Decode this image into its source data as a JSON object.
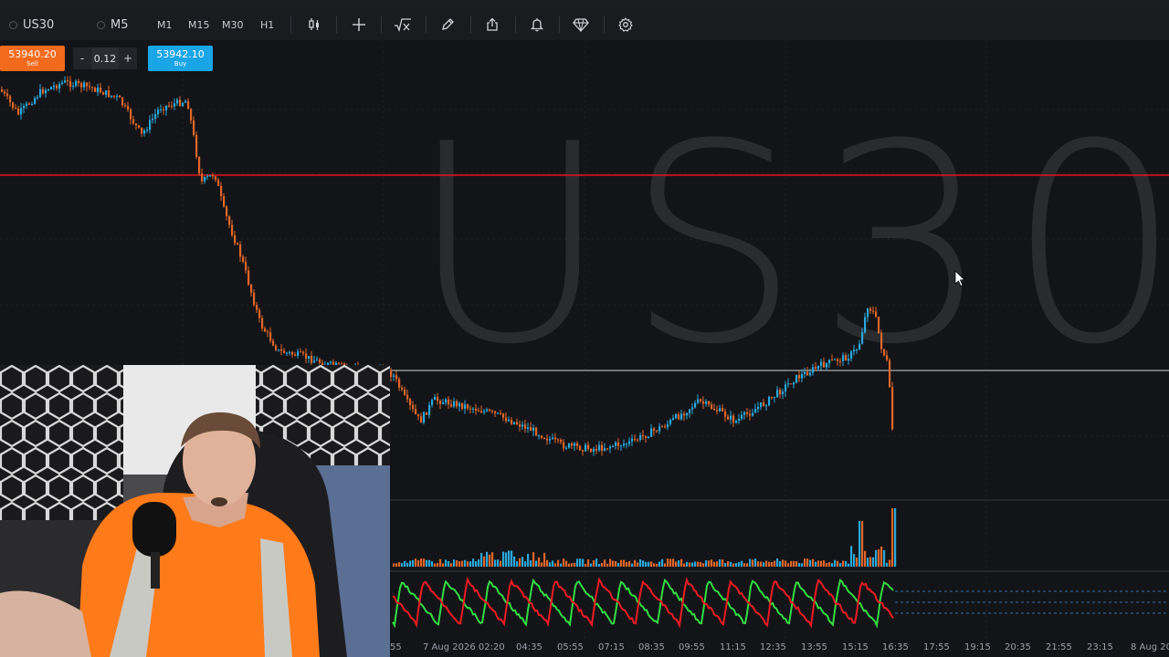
{
  "toolbar": {
    "symbol": "US30",
    "timeframe_selected": "M5",
    "timeframes": [
      "M1",
      "M15",
      "M30",
      "H1"
    ]
  },
  "trade": {
    "sell_price": "53940.20",
    "sell_label": "Sell",
    "buy_price": "53942.10",
    "buy_label": "Buy",
    "minus": "-",
    "plus": "+",
    "quantity": "0.12"
  },
  "chart": {
    "watermark": "US30",
    "x_ticks": [
      "55",
      "7 Aug 2026 02:20",
      "04:35",
      "05:55",
      "07:15",
      "08:35",
      "09:55",
      "11:15",
      "12:35",
      "13:55",
      "15:15",
      "16:35",
      "17:55",
      "19:15",
      "20:35",
      "21:55",
      "23:15",
      "8 Aug 20"
    ],
    "colors": {
      "up": "#2aa7dc",
      "down": "#e0662a",
      "level": "#e0141e",
      "osc_a": "#33dd44",
      "osc_b": "#ee1c24",
      "bg": "#131417"
    }
  }
}
